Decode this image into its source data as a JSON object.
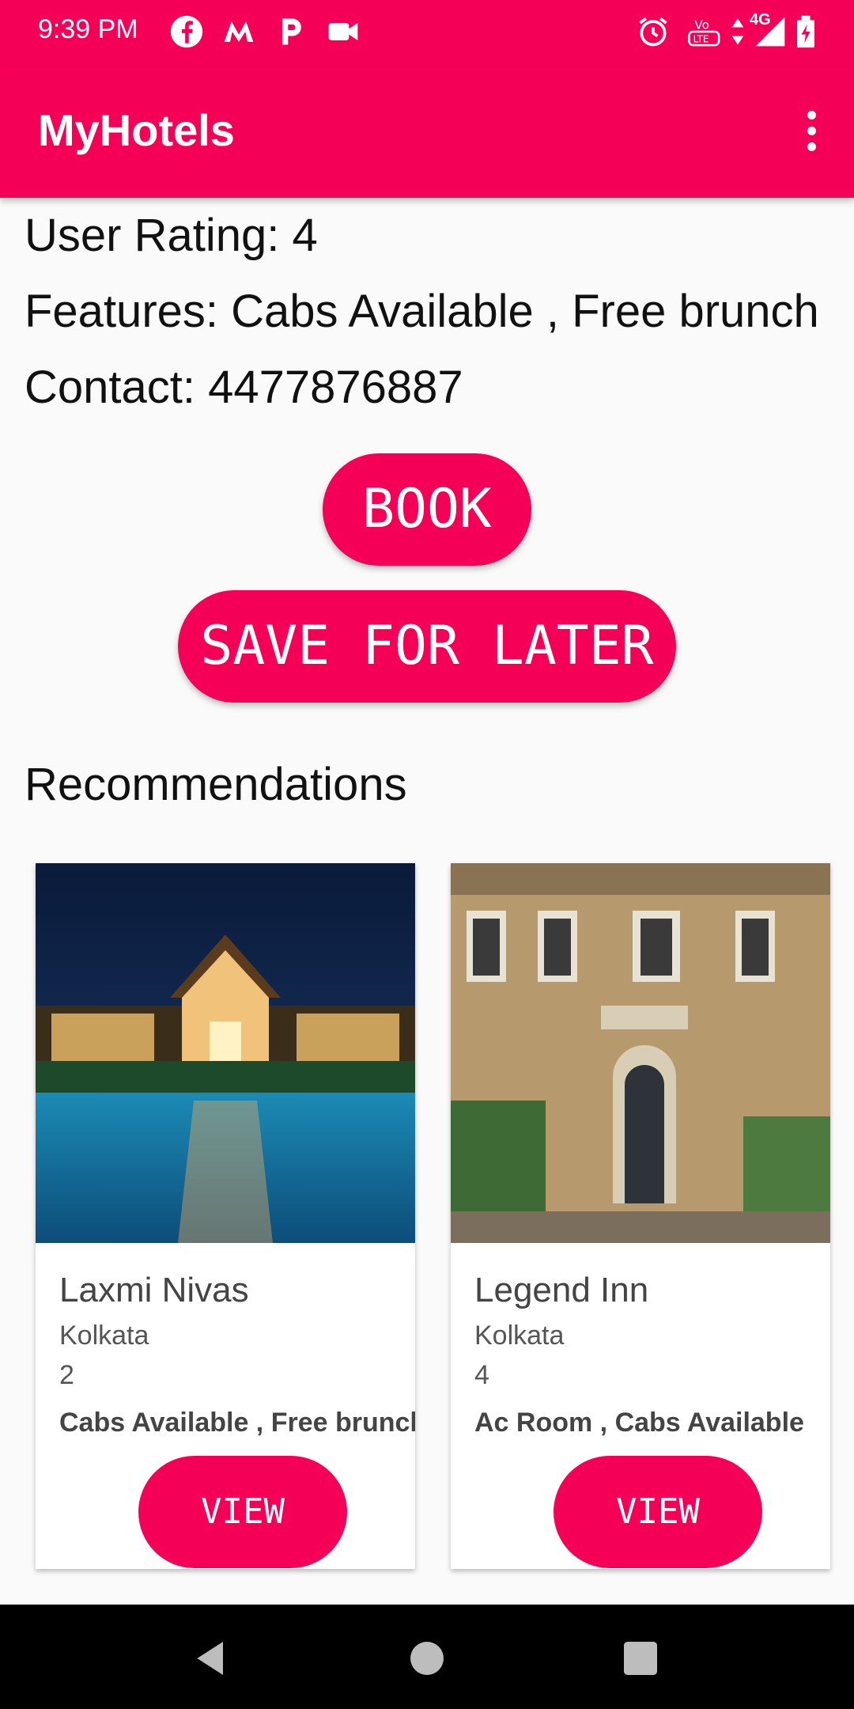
{
  "status_bar": {
    "time": "9:39 PM",
    "network": "4G"
  },
  "app_bar": {
    "title": "MyHotels"
  },
  "details": {
    "rating": "User Rating: 4",
    "features": "Features: Cabs Available , Free brunch",
    "contact": "Contact: 4477876887"
  },
  "actions": {
    "book_label": "BOOK",
    "save_label": "SAVE FOR LATER"
  },
  "recommendations": {
    "heading": "Recommendations",
    "cards": [
      {
        "name": "Laxmi Nivas",
        "city": "Kolkata",
        "rating": "2",
        "features": "Cabs Available , Free brunch",
        "button": "VIEW",
        "image": "resort-pool-photo"
      },
      {
        "name": "Legend Inn",
        "city": "Kolkata",
        "rating": "4",
        "features": "Ac Room , Cabs Available",
        "button": "VIEW",
        "image": "building-facade-photo"
      }
    ]
  },
  "colors": {
    "accent": "#f50057",
    "background": "#fafafa",
    "navbar": "#000000"
  },
  "icons": [
    "facebook-icon",
    "maps-icon",
    "paytm-icon",
    "video-icon",
    "alarm-icon",
    "volte-icon",
    "signal-icon",
    "battery-icon",
    "overflow-menu-icon",
    "back-icon",
    "home-icon",
    "recents-icon"
  ]
}
